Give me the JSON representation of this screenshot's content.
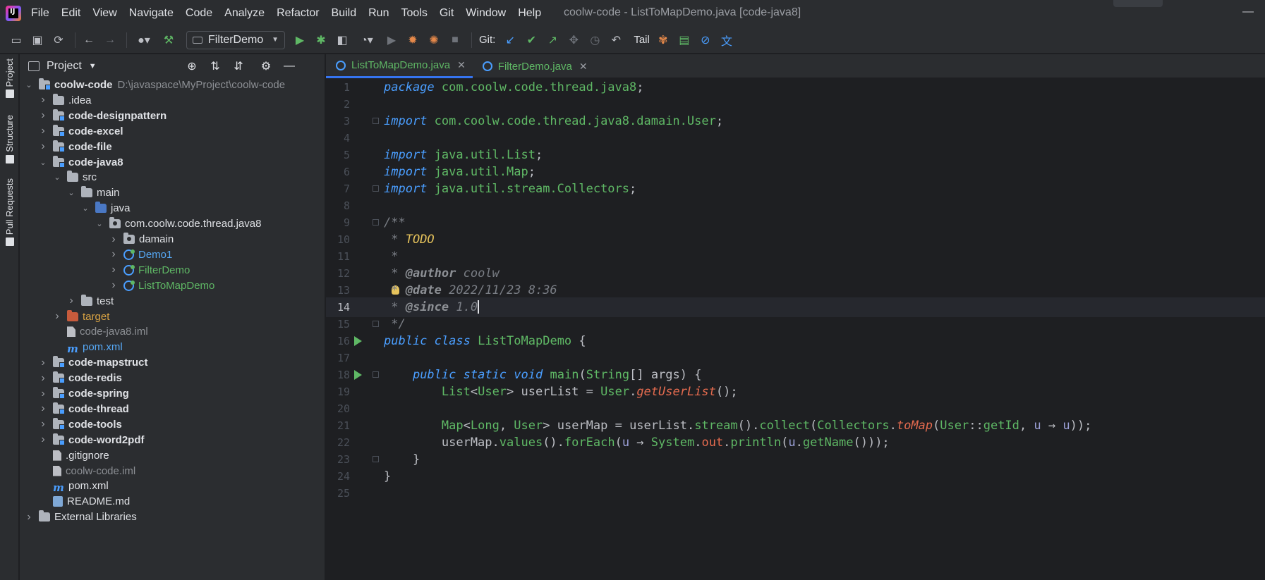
{
  "menubar": {
    "items": [
      "File",
      "Edit",
      "View",
      "Navigate",
      "Code",
      "Analyze",
      "Refactor",
      "Build",
      "Run",
      "Tools",
      "Git",
      "Window",
      "Help"
    ],
    "window_title": "coolw-code - ListToMapDemo.java [code-java8]"
  },
  "toolbar": {
    "run_config": "FilterDemo",
    "git_label": "Git:",
    "tail_label": "Tail"
  },
  "tool_strip": {
    "project": "Project",
    "structure": "Structure",
    "pull_requests": "Pull Requests"
  },
  "project": {
    "title": "Project",
    "root_name": "coolw-code",
    "root_path": "D:\\javaspace\\MyProject\\coolw-code",
    "tree": [
      {
        "label": "coolw-code",
        "depth": 0,
        "expanded": true,
        "icon": "module-folder",
        "style": "bold"
      },
      {
        "label": ".idea",
        "depth": 1,
        "expanded": false,
        "icon": "folder",
        "style": "normal"
      },
      {
        "label": "code-designpattern",
        "depth": 1,
        "expanded": false,
        "icon": "module-folder",
        "style": "bold"
      },
      {
        "label": "code-excel",
        "depth": 1,
        "expanded": false,
        "icon": "module-folder",
        "style": "bold"
      },
      {
        "label": "code-file",
        "depth": 1,
        "expanded": false,
        "icon": "module-folder",
        "style": "bold"
      },
      {
        "label": "code-java8",
        "depth": 1,
        "expanded": true,
        "icon": "module-folder",
        "style": "bold"
      },
      {
        "label": "src",
        "depth": 2,
        "expanded": true,
        "icon": "folder",
        "style": "normal"
      },
      {
        "label": "main",
        "depth": 3,
        "expanded": true,
        "icon": "folder",
        "style": "normal"
      },
      {
        "label": "java",
        "depth": 4,
        "expanded": true,
        "icon": "src-folder",
        "style": "normal"
      },
      {
        "label": "com.coolw.code.thread.java8",
        "depth": 5,
        "expanded": true,
        "icon": "package",
        "style": "normal"
      },
      {
        "label": "damain",
        "depth": 6,
        "expanded": false,
        "icon": "package",
        "style": "normal"
      },
      {
        "label": "Demo1",
        "depth": 6,
        "expanded": false,
        "icon": "class",
        "style": "link"
      },
      {
        "label": "FilterDemo",
        "depth": 6,
        "expanded": false,
        "icon": "class",
        "style": "green"
      },
      {
        "label": "ListToMapDemo",
        "depth": 6,
        "expanded": false,
        "icon": "class",
        "style": "green"
      },
      {
        "label": "test",
        "depth": 3,
        "expanded": false,
        "icon": "folder",
        "style": "normal"
      },
      {
        "label": "target",
        "depth": 2,
        "expanded": false,
        "icon": "target-folder",
        "style": "excluded"
      },
      {
        "label": "code-java8.iml",
        "depth": 2,
        "expanded": null,
        "icon": "file",
        "style": "dim"
      },
      {
        "label": "pom.xml",
        "depth": 2,
        "expanded": null,
        "icon": "maven",
        "style": "link"
      },
      {
        "label": "code-mapstruct",
        "depth": 1,
        "expanded": false,
        "icon": "module-folder",
        "style": "bold"
      },
      {
        "label": "code-redis",
        "depth": 1,
        "expanded": false,
        "icon": "module-folder",
        "style": "bold"
      },
      {
        "label": "code-spring",
        "depth": 1,
        "expanded": false,
        "icon": "module-folder",
        "style": "bold"
      },
      {
        "label": "code-thread",
        "depth": 1,
        "expanded": false,
        "icon": "module-folder",
        "style": "bold"
      },
      {
        "label": "code-tools",
        "depth": 1,
        "expanded": false,
        "icon": "module-folder",
        "style": "bold"
      },
      {
        "label": "code-word2pdf",
        "depth": 1,
        "expanded": false,
        "icon": "module-folder",
        "style": "bold"
      },
      {
        "label": ".gitignore",
        "depth": 1,
        "expanded": null,
        "icon": "file",
        "style": "normal"
      },
      {
        "label": "coolw-code.iml",
        "depth": 1,
        "expanded": null,
        "icon": "file",
        "style": "dim"
      },
      {
        "label": "pom.xml",
        "depth": 1,
        "expanded": null,
        "icon": "maven",
        "style": "normal"
      },
      {
        "label": "README.md",
        "depth": 1,
        "expanded": null,
        "icon": "markdown",
        "style": "normal"
      },
      {
        "label": "External Libraries",
        "depth": 0,
        "expanded": false,
        "icon": "library",
        "style": "normal"
      }
    ]
  },
  "editor": {
    "tabs": [
      {
        "label": "ListToMapDemo.java",
        "active": true
      },
      {
        "label": "FilterDemo.java",
        "active": false
      }
    ],
    "current_line": 14,
    "lines": [
      [
        [
          "kw",
          "package"
        ],
        [
          "t",
          " "
        ],
        [
          "pk",
          "com.coolw.code.thread.java8"
        ],
        [
          "t",
          ";"
        ]
      ],
      [],
      [
        [
          "kw",
          "import"
        ],
        [
          "t",
          " "
        ],
        [
          "pk",
          "com.coolw.code.thread.java8.damain.User"
        ],
        [
          "t",
          ";"
        ]
      ],
      [],
      [
        [
          "kw",
          "import"
        ],
        [
          "t",
          " "
        ],
        [
          "pk",
          "java.util."
        ],
        [
          "ty",
          "List"
        ],
        [
          "t",
          ";"
        ]
      ],
      [
        [
          "kw",
          "import"
        ],
        [
          "t",
          " "
        ],
        [
          "pk",
          "java.util."
        ],
        [
          "ty",
          "Map"
        ],
        [
          "t",
          ";"
        ]
      ],
      [
        [
          "kw",
          "import"
        ],
        [
          "t",
          " "
        ],
        [
          "pk",
          "java.util.stream.Collectors"
        ],
        [
          "t",
          ";"
        ]
      ],
      [],
      [
        [
          "cm",
          "/**"
        ]
      ],
      [
        [
          "cm",
          " * "
        ],
        [
          "todo",
          "TODO"
        ]
      ],
      [
        [
          "cm",
          " *"
        ]
      ],
      [
        [
          "cm",
          " * "
        ],
        [
          "tag",
          "@author"
        ],
        [
          "cm",
          " coolw"
        ]
      ],
      [
        [
          "cm",
          " * "
        ],
        [
          "tag",
          "@date"
        ],
        [
          "cm",
          " 2022/11/23 8:36"
        ]
      ],
      [
        [
          "cm",
          " * "
        ],
        [
          "tag",
          "@since"
        ],
        [
          "cm",
          " 1.0"
        ],
        [
          "caret",
          ""
        ]
      ],
      [
        [
          "cm",
          " */"
        ]
      ],
      [
        [
          "kw",
          "public"
        ],
        [
          "t",
          " "
        ],
        [
          "kw",
          "class"
        ],
        [
          "t",
          " "
        ],
        [
          "ty",
          "ListToMapDemo"
        ],
        [
          "t",
          " {"
        ]
      ],
      [],
      [
        [
          "t",
          "    "
        ],
        [
          "kw",
          "public"
        ],
        [
          "t",
          " "
        ],
        [
          "kw",
          "static"
        ],
        [
          "t",
          " "
        ],
        [
          "kw",
          "void"
        ],
        [
          "t",
          " "
        ],
        [
          "mth",
          "main"
        ],
        [
          "t",
          "("
        ],
        [
          "ty",
          "String"
        ],
        [
          "t",
          "[] args) {"
        ]
      ],
      [
        [
          "t",
          "        "
        ],
        [
          "ty",
          "List"
        ],
        [
          "t",
          "<"
        ],
        [
          "ty",
          "User"
        ],
        [
          "t",
          "> userList = "
        ],
        [
          "ty",
          "User"
        ],
        [
          "t",
          "."
        ],
        [
          "fnc",
          "getUserList"
        ],
        [
          "t",
          "();"
        ]
      ],
      [],
      [
        [
          "t",
          "        "
        ],
        [
          "ty",
          "Map"
        ],
        [
          "t",
          "<"
        ],
        [
          "ty",
          "Long"
        ],
        [
          "t",
          ", "
        ],
        [
          "ty",
          "User"
        ],
        [
          "t",
          "> userMap = userList."
        ],
        [
          "mth",
          "stream"
        ],
        [
          "t",
          "()."
        ],
        [
          "mth",
          "collect"
        ],
        [
          "t",
          "("
        ],
        [
          "ty",
          "Collectors"
        ],
        [
          "t",
          "."
        ],
        [
          "fnc",
          "toMap"
        ],
        [
          "t",
          "("
        ],
        [
          "ty",
          "User"
        ],
        [
          "t",
          "::"
        ],
        [
          "mth",
          "getId"
        ],
        [
          "t",
          ", "
        ],
        [
          "prm",
          "u"
        ],
        [
          "t",
          " → "
        ],
        [
          "prm",
          "u"
        ],
        [
          "t",
          "));"
        ]
      ],
      [
        [
          "t",
          "        userMap."
        ],
        [
          "mth",
          "values"
        ],
        [
          "t",
          "()."
        ],
        [
          "mth",
          "forEach"
        ],
        [
          "t",
          "("
        ],
        [
          "prm",
          "u"
        ],
        [
          "t",
          " → "
        ],
        [
          "ty",
          "System"
        ],
        [
          "t",
          "."
        ],
        [
          "fld",
          "out"
        ],
        [
          "t",
          "."
        ],
        [
          "mth",
          "println"
        ],
        [
          "t",
          "("
        ],
        [
          "prm",
          "u"
        ],
        [
          "t",
          "."
        ],
        [
          "mth",
          "getName"
        ],
        [
          "t",
          "()));"
        ]
      ],
      [
        [
          "t",
          "    }"
        ]
      ],
      [
        [
          "t",
          "}"
        ]
      ],
      []
    ]
  },
  "colors": {
    "accent": "#3574f0",
    "keyword": "#4a9eff",
    "type": "#5fb865",
    "method_static": "#e56b4f",
    "comment": "#7a7e85"
  }
}
